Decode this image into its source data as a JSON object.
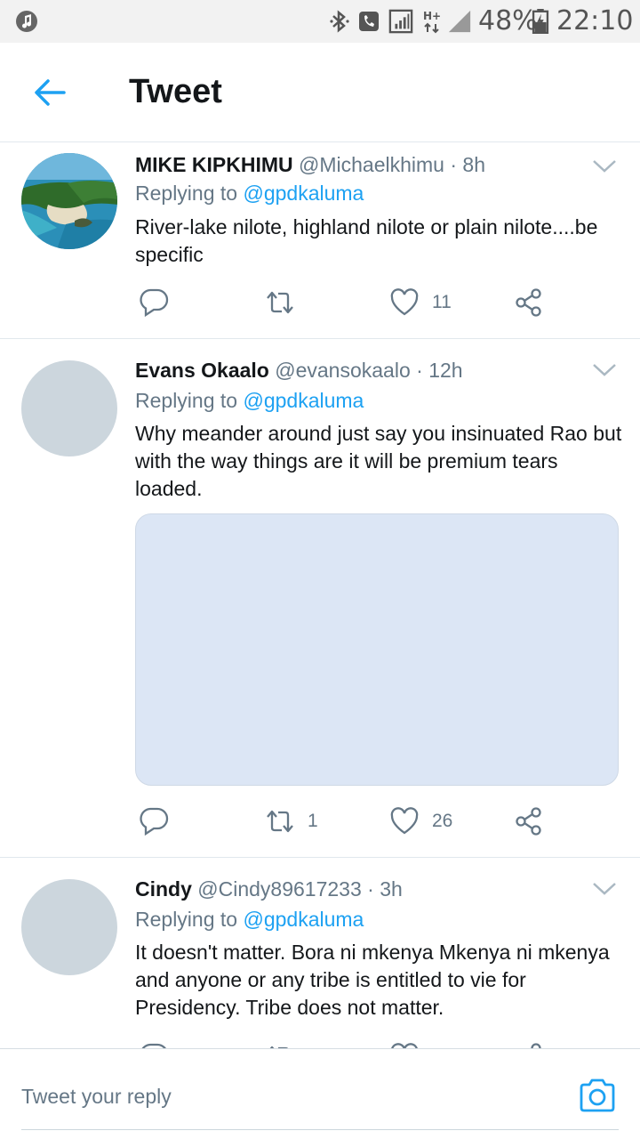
{
  "status_bar": {
    "battery": "48%",
    "time": "22:10",
    "icons": [
      "music-icon",
      "bluetooth-icon",
      "call-icon",
      "sim-signal-icon",
      "hplus-icon",
      "signal-icon",
      "battery-icon"
    ]
  },
  "header": {
    "back_icon": "arrow-left-icon",
    "title": "Tweet"
  },
  "tweets": [
    {
      "name": "MIKE KIPKHIMU",
      "handle": "@Michaelkhimu",
      "time": "· 8h",
      "replying_prefix": "Replying to",
      "replying_to": "@gpdkaluma",
      "text": "River-lake nilote, highland nilote or plain nilote....be specific",
      "retweets": "",
      "likes": "11"
    },
    {
      "name": "Evans Okaalo",
      "handle": "@evansokaalo",
      "time": "· 12h",
      "replying_prefix": "Replying to",
      "replying_to": "@gpdkaluma",
      "text": "Why meander around just say you insinuated Rao but with the way things are it will be premium tears loaded.",
      "retweets": "1",
      "likes": "26"
    },
    {
      "name": "Cindy",
      "handle": "@Cindy89617233",
      "time": "· 3h",
      "replying_prefix": "Replying to",
      "replying_to": "@gpdkaluma",
      "text": "It doesn't matter. Bora ni mkenya Mkenya ni mkenya and anyone or any tribe is entitled to vie for Presidency. Tribe does not matter."
    }
  ],
  "compose": {
    "placeholder": "Tweet your reply",
    "camera_icon": "camera-icon"
  },
  "colors": {
    "accent": "#1da1f2",
    "secondary_text": "#657786",
    "avatar_placeholder": "#ccd6dd",
    "media_placeholder": "#dce6f5"
  }
}
